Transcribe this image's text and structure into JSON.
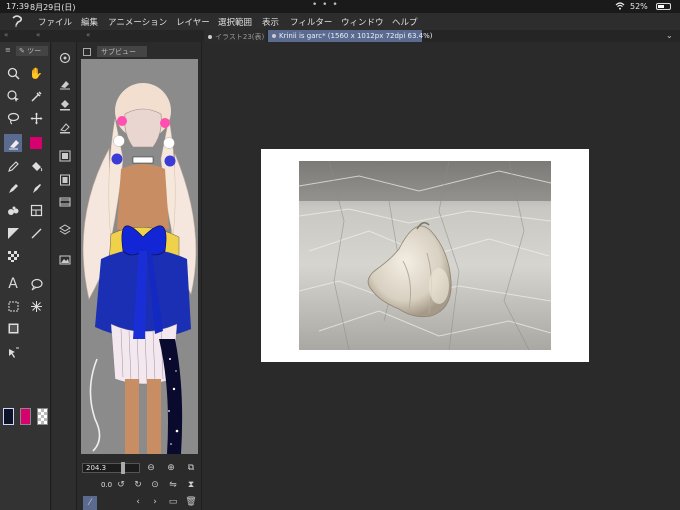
{
  "status": {
    "time": "17:39",
    "date": "8月29日(日)",
    "battery": "52%",
    "battery_level": 0.52,
    "dots": "• • •"
  },
  "menu": [
    "ファイル",
    "編集",
    "アニメーション",
    "レイヤー",
    "選択範囲",
    "表示",
    "フィルター",
    "ウィンドウ",
    "ヘルプ"
  ],
  "tabs": {
    "chevrons": "«",
    "inactive": "イラスト23(表)",
    "active": "Krinii is garc* (1560 x 1012px 72dpi 63.4%)",
    "expand": "⌄"
  },
  "tool_panel": {
    "tab_label": "ツー"
  },
  "sub_view": {
    "title": "サブビュー",
    "zoom": "204.3",
    "rotation": "0.0"
  },
  "colors": {
    "main": "#0d1226",
    "sub": "#d6006f",
    "accent": "#5a6b8f"
  }
}
